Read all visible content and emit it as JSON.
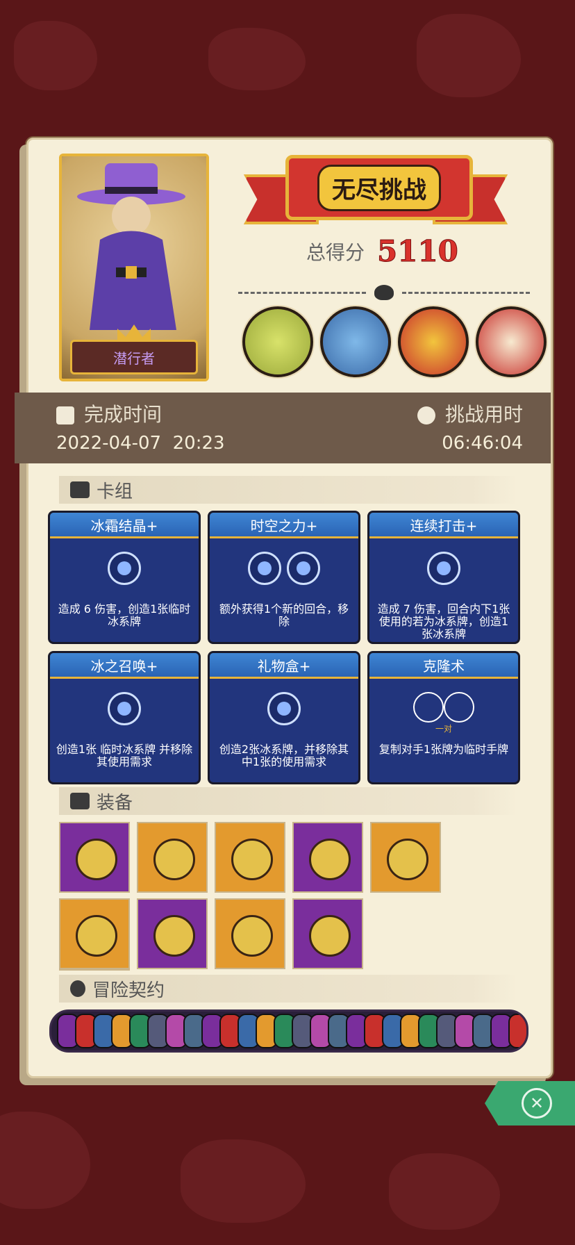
{
  "header": {
    "character_name": "潜行者",
    "mode_title": "无尽挑战",
    "score_label": "总得分",
    "score_value": "5110"
  },
  "time": {
    "finish_label": "完成时间",
    "finish_value": "2022-04-07  20:23",
    "duration_label": "挑战用时",
    "duration_value": "06:46:04"
  },
  "sections": {
    "deck": "卡组",
    "equipment": "装备",
    "contract": "冒险契约"
  },
  "cards": [
    {
      "title": "冰霜结晶+",
      "icons": 1,
      "desc": "造成 6 伤害，创造1张临时冰系牌",
      "sub": ""
    },
    {
      "title": "时空之力+",
      "icons": 2,
      "desc": "额外获得1个新的回合，移除",
      "sub": ""
    },
    {
      "title": "连续打击+",
      "icons": 1,
      "desc": "造成 7 伤害，回合内下1张使用的若为冰系牌，创造1张冰系牌",
      "sub": ""
    },
    {
      "title": "冰之召唤+",
      "icons": 1,
      "desc": "创造1张 临时冰系牌 并移除其使用需求",
      "sub": ""
    },
    {
      "title": "礼物盒+",
      "icons": 1,
      "desc": "创造2张冰系牌，并移除其中1张的使用需求",
      "sub": ""
    },
    {
      "title": "克隆术",
      "icons": 0,
      "desc": "复制对手1张牌为临时手牌",
      "sub": "一对"
    }
  ],
  "equipment": {
    "row1": [
      "purple",
      "orange",
      "orange",
      "purple",
      "orange",
      "purple"
    ],
    "row2": [
      "orange",
      "purple",
      "orange",
      "purple"
    ]
  },
  "colors": {
    "background": "#5a1618",
    "panel": "#f6efd9",
    "card": "#22357d",
    "accent_gold": "#e7b43a",
    "score_red": "#d9322c",
    "close_green": "#3aa870"
  }
}
